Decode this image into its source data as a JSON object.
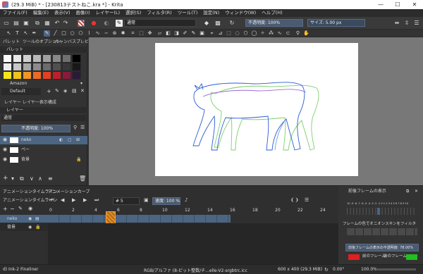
{
  "window": {
    "title": "(29.3 MiB) * - [230813テストねこ.kra *] - Krita",
    "minimize": "—",
    "maximize": "☐",
    "close": "✕"
  },
  "menu": [
    "ファイル(F)",
    "編集(E)",
    "表示(V)",
    "画像(I)",
    "レイヤー(L)",
    "選択(S)",
    "フィルタ(R)",
    "ツール(T)",
    "設定(N)",
    "ウィンドウ(W)",
    "ヘルプ(H)"
  ],
  "toolbar": {
    "blend_mode": "通常",
    "opacity": "不透明度: 100%",
    "size": "サイズ: 5.00 px"
  },
  "left_tabs": {
    "top": [
      "パレット",
      "ツールのオプション",
      "キャンバスプレビュー"
    ],
    "palette_title": "パレット",
    "palette_name": "Amazon",
    "palette_set": "Default",
    "palette_colors": [
      "#ffffff",
      "#e8e8e8",
      "#d0d0d0",
      "#b8b8b8",
      "#a0a0a0",
      "#888888",
      "#707070",
      "#000000",
      "#ececec",
      "#c8c8c8",
      "#a8a8a8",
      "#8c8c8c",
      "#6c6c6c",
      "#505050",
      "#383838",
      "#181818",
      "#f5e51d",
      "#f2c21a",
      "#f29423",
      "#ee6a22",
      "#e33f22",
      "#c01e2a",
      "#8a1a3c",
      "#2a1a3a"
    ],
    "layer_tabs": [
      "レイヤー",
      "レイヤー表示構成"
    ],
    "layer_header": "レイヤー",
    "layer_blend": "通常",
    "layer_opacity": "不透明度: 100%",
    "layers": [
      {
        "name": "neko"
      },
      {
        "name": "ペー"
      },
      {
        "name": "背景"
      }
    ]
  },
  "bottom": {
    "tabs": [
      "アニメーションタイムライン",
      "アニメーションカーブ"
    ],
    "timeline_title": "アニメーションタイムライン",
    "frame_field": "# 5",
    "speed_label": "速度: 100 %",
    "frame_numbers": [
      "0",
      "2",
      "4",
      "6",
      "8",
      "10",
      "12",
      "14",
      "16",
      "18",
      "20",
      "22",
      "24"
    ],
    "tracks": [
      {
        "name": "neko"
      },
      {
        "name": "背景"
      }
    ],
    "onion": {
      "title": "前後フレームの表示",
      "numbers": "10 -9 -8 -7 -6 -5 -4 -3 -2 -1 0 1 2 3 4 5 6 7 8 9 10",
      "filter_label": "フレームの色でオニオンスキンをフィルタ",
      "opacity_field": "前後フレームの表示の不透明度: 78.00%",
      "prev_label": "前のフレーム",
      "next_label": "後のフレーム",
      "prev_color": "#e02020",
      "next_color": "#20c020"
    }
  },
  "status": {
    "brush": "d) Ink-2 Fineliner",
    "color_profile": "RGB/アルファ (8-ビット整数/チ...elle-V2-srgbtrc.icc",
    "dimensions": "600 x 400 (29.3 MiB)",
    "rotation": "0.00°",
    "zoom": "100.0%"
  },
  "accent": "#4b6583"
}
